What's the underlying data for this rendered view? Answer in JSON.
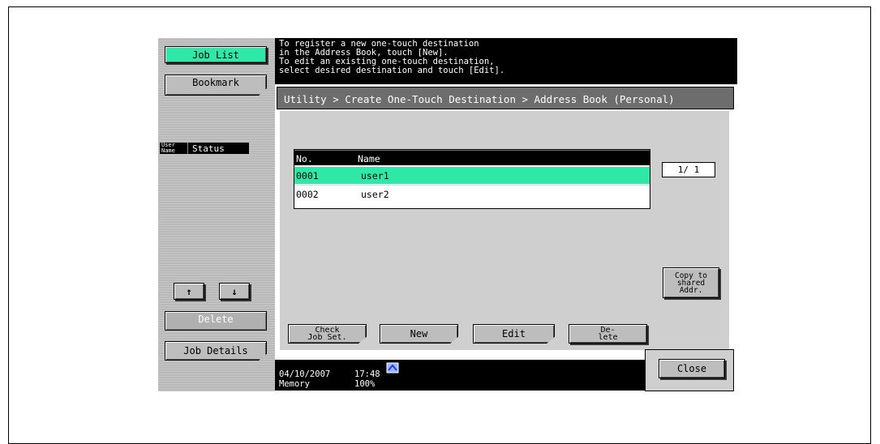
{
  "sidebar": {
    "job_list_label": "Job List",
    "bookmark_label": "Bookmark",
    "col_user_name_line1": "User",
    "col_user_name_line2": "Name",
    "col_status": "Status",
    "up_arrow_glyph": "↑",
    "down_arrow_glyph": "↓",
    "delete_label": "Delete",
    "job_details_label": "Job Details"
  },
  "message": {
    "line1": "To register a new one-touch destination",
    "line2": "in the Address Book, touch [New].",
    "line3": "To edit an existing one-touch destination,",
    "line4": "select desired destination and touch [Edit]."
  },
  "breadcrumb": "Utility > Create One-Touch Destination > Address Book (Personal)",
  "list": {
    "headers": [
      "No.",
      "Name"
    ],
    "rows": [
      {
        "no": "0001",
        "name": "user1",
        "selected": true
      },
      {
        "no": "0002",
        "name": "user2",
        "selected": false
      }
    ],
    "page_indicator": "1/  1"
  },
  "copy_button": {
    "line1": "Copy to",
    "line2": "shared",
    "line3": "Addr."
  },
  "actions": {
    "check_line1": "Check",
    "check_line2": "Job Set.",
    "new_label": "New",
    "edit_label": "Edit",
    "delete_line1": "De-",
    "delete_line2": "lete"
  },
  "status_bar": {
    "date": "04/10/2007",
    "time": "17:48",
    "memory_label": "Memory",
    "memory_value": "100%"
  },
  "close_label": "Close",
  "colors": {
    "accent_green": "#2ee8a8",
    "message_bg": "#000000",
    "panel_gray": "#cfcfcf"
  }
}
